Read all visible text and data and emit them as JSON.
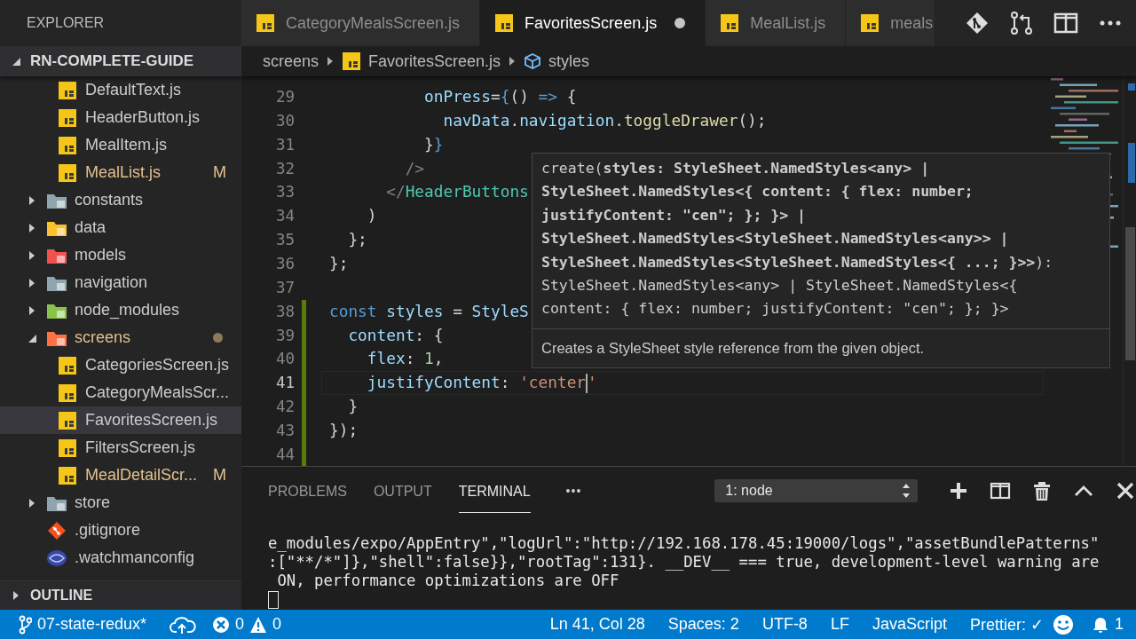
{
  "sidebar": {
    "title": "EXPLORER",
    "project": {
      "name": "RN-COMPLETE-GUIDE",
      "expanded": true
    },
    "tree": [
      {
        "kind": "continued",
        "children": [
          {
            "kind": "file",
            "name": "DefaultText.js",
            "modified": false,
            "selected": false
          },
          {
            "kind": "file",
            "name": "HeaderButton.js",
            "modified": false,
            "selected": false
          },
          {
            "kind": "file",
            "name": "MealItem.js",
            "modified": false,
            "selected": false
          },
          {
            "kind": "file",
            "name": "MealList.js",
            "modified": true,
            "badge": "M",
            "selected": false
          }
        ]
      },
      {
        "kind": "folder",
        "name": "constants",
        "color": "#90a4ae",
        "expanded": false,
        "modified": false
      },
      {
        "kind": "folder",
        "name": "data",
        "color": "#fbc02d",
        "expanded": false,
        "modified": false
      },
      {
        "kind": "folder",
        "name": "models",
        "color": "#ef5350",
        "expanded": false,
        "modified": false
      },
      {
        "kind": "folder",
        "name": "navigation",
        "color": "#90a4ae",
        "expanded": false,
        "modified": false
      },
      {
        "kind": "folder",
        "name": "node_modules",
        "color": "#8bc34a",
        "expanded": false,
        "modified": false
      },
      {
        "kind": "folder",
        "name": "screens",
        "color": "#ff7043",
        "expanded": true,
        "modified": true,
        "children": [
          {
            "kind": "file",
            "name": "CategoriesScreen.js",
            "modified": false,
            "selected": false
          },
          {
            "kind": "file",
            "name": "CategoryMealsScr...",
            "modified": false,
            "selected": false
          },
          {
            "kind": "file",
            "name": "FavoritesScreen.js",
            "modified": false,
            "selected": true
          },
          {
            "kind": "file",
            "name": "FiltersScreen.js",
            "modified": false,
            "selected": false
          },
          {
            "kind": "file",
            "name": "MealDetailScr...",
            "modified": true,
            "badge": "M",
            "selected": false
          }
        ]
      },
      {
        "kind": "folder",
        "name": "store",
        "color": "#90a4ae",
        "expanded": false,
        "modified": false
      },
      {
        "kind": "git",
        "name": ".gitignore",
        "modified": false,
        "selected": false
      },
      {
        "kind": "config",
        "name": ".watchmanconfig",
        "modified": false,
        "selected": false
      }
    ],
    "outline": {
      "title": "OUTLINE",
      "expanded": false
    }
  },
  "tabs": [
    {
      "label": "CategoryMealsScreen.js",
      "selected": false,
      "dirty": false
    },
    {
      "label": "FavoritesScreen.js",
      "selected": true,
      "dirty": true
    },
    {
      "label": "MealList.js",
      "selected": false,
      "dirty": false
    },
    {
      "label": "meals",
      "selected": false,
      "dirty": false
    }
  ],
  "breadcrumb": [
    {
      "kind": "folder",
      "label": "screens"
    },
    {
      "kind": "file",
      "label": "FavoritesScreen.js"
    },
    {
      "kind": "symbol",
      "label": "styles"
    }
  ],
  "code": [
    {
      "number": "29",
      "added": false,
      "current": false,
      "tokens": [
        {
          "kind": "var",
          "text": "          onPress"
        },
        {
          "kind": "pun",
          "text": "="
        },
        {
          "kind": "kw",
          "text": "{"
        },
        {
          "kind": "pun",
          "text": "() "
        },
        {
          "kind": "kw",
          "text": "=>"
        },
        {
          "kind": "pun",
          "text": " {"
        }
      ]
    },
    {
      "number": "30",
      "added": false,
      "current": false,
      "tokens": [
        {
          "kind": "var",
          "text": "            navData"
        },
        {
          "kind": "pun",
          "text": "."
        },
        {
          "kind": "var",
          "text": "navigation"
        },
        {
          "kind": "pun",
          "text": "."
        },
        {
          "kind": "fn",
          "text": "toggleDrawer"
        },
        {
          "kind": "pun",
          "text": "();"
        }
      ]
    },
    {
      "number": "31",
      "added": false,
      "current": false,
      "tokens": [
        {
          "kind": "pun",
          "text": "          }"
        },
        {
          "kind": "kw",
          "text": "}"
        }
      ]
    },
    {
      "number": "32",
      "added": false,
      "current": false,
      "tokens": [
        {
          "kind": "gray",
          "text": "        />"
        }
      ]
    },
    {
      "number": "33",
      "added": false,
      "current": false,
      "tokens": [
        {
          "kind": "gray",
          "text": "      </"
        },
        {
          "kind": "tag",
          "text": "HeaderButtons"
        }
      ]
    },
    {
      "number": "34",
      "added": false,
      "current": false,
      "tokens": [
        {
          "kind": "pun",
          "text": "    )"
        }
      ]
    },
    {
      "number": "35",
      "added": false,
      "current": false,
      "tokens": [
        {
          "kind": "pun",
          "text": "  };"
        }
      ]
    },
    {
      "number": "36",
      "added": false,
      "current": false,
      "tokens": [
        {
          "kind": "pun",
          "text": "};"
        }
      ]
    },
    {
      "number": "37",
      "added": false,
      "current": false
    },
    {
      "number": "38",
      "added": true,
      "current": false,
      "tokens": [
        {
          "kind": "kw",
          "text": "const"
        },
        {
          "kind": "var",
          "text": " styles"
        },
        {
          "kind": "pun",
          "text": " = "
        },
        {
          "kind": "var",
          "text": "StyleS"
        }
      ]
    },
    {
      "number": "39",
      "added": true,
      "current": false,
      "tokens": [
        {
          "kind": "var",
          "text": "  content"
        },
        {
          "kind": "pun",
          "text": ": {"
        }
      ]
    },
    {
      "number": "40",
      "added": true,
      "current": false,
      "tokens": [
        {
          "kind": "var",
          "text": "    flex"
        },
        {
          "kind": "pun",
          "text": ": "
        },
        {
          "kind": "num",
          "text": "1"
        },
        {
          "kind": "pun",
          "text": ","
        }
      ]
    },
    {
      "number": "41",
      "added": true,
      "current": true,
      "tokens": [
        {
          "kind": "var",
          "text": "    justifyContent"
        },
        {
          "kind": "pun",
          "text": ": "
        },
        {
          "kind": "str",
          "text": "'center"
        },
        {
          "kind": "cursor"
        },
        {
          "kind": "str",
          "text": "'"
        }
      ]
    },
    {
      "number": "42",
      "added": true,
      "current": false,
      "tokens": [
        {
          "kind": "pun",
          "text": "  }"
        }
      ]
    },
    {
      "number": "43",
      "added": true,
      "current": false,
      "tokens": [
        {
          "kind": "pun",
          "text": "});"
        }
      ]
    },
    {
      "number": "44",
      "added": true,
      "current": false
    }
  ],
  "hover": {
    "signature": [
      "create(**styles: StyleSheet.NamedStyles<any> |**",
      "**StyleSheet.NamedStyles<{ content: { flex: number;**",
      "**justifyContent: \"cen\"; }; }> |**",
      "**StyleSheet.NamedStyles<StyleSheet.NamedStyles<any>> |**",
      "**StyleSheet.NamedStyles<StyleSheet.NamedStyles<{ ...; }>>**):",
      "StyleSheet.NamedStyles<any> | StyleSheet.NamedStyles<{",
      "content: { flex: number; justifyContent: \"cen\"; }; }>"
    ],
    "doc": "Creates a StyleSheet style reference from the given object."
  },
  "panel": {
    "tabs": [
      {
        "label": "PROBLEMS",
        "selected": false
      },
      {
        "label": "OUTPUT",
        "selected": false
      },
      {
        "label": "TERMINAL",
        "selected": true
      }
    ],
    "more": "•••",
    "terminal_select": "1: node",
    "terminal": [
      "e_modules/expo/AppEntry\",\"logUrl\":\"http://192.168.178.45:19000/logs\",\"assetBundlePatterns\"",
      ":[\"**/*\"]},\"shell\":false}},\"rootTag\":131}. __DEV__ === true, development-level warning are",
      " ON, performance optimizations are OFF"
    ]
  },
  "status_bar": {
    "branch": "07-state-redux*",
    "errors": "0",
    "warnings": "0",
    "right": [
      {
        "kind": "text",
        "label": "Ln 41, Col 28"
      },
      {
        "kind": "text",
        "label": "Spaces: 2"
      },
      {
        "kind": "text",
        "label": "UTF-8"
      },
      {
        "kind": "text",
        "label": "LF"
      },
      {
        "kind": "text",
        "label": "JavaScript"
      },
      {
        "kind": "text",
        "label": "Prettier: ✓"
      }
    ],
    "notifications": "1"
  }
}
